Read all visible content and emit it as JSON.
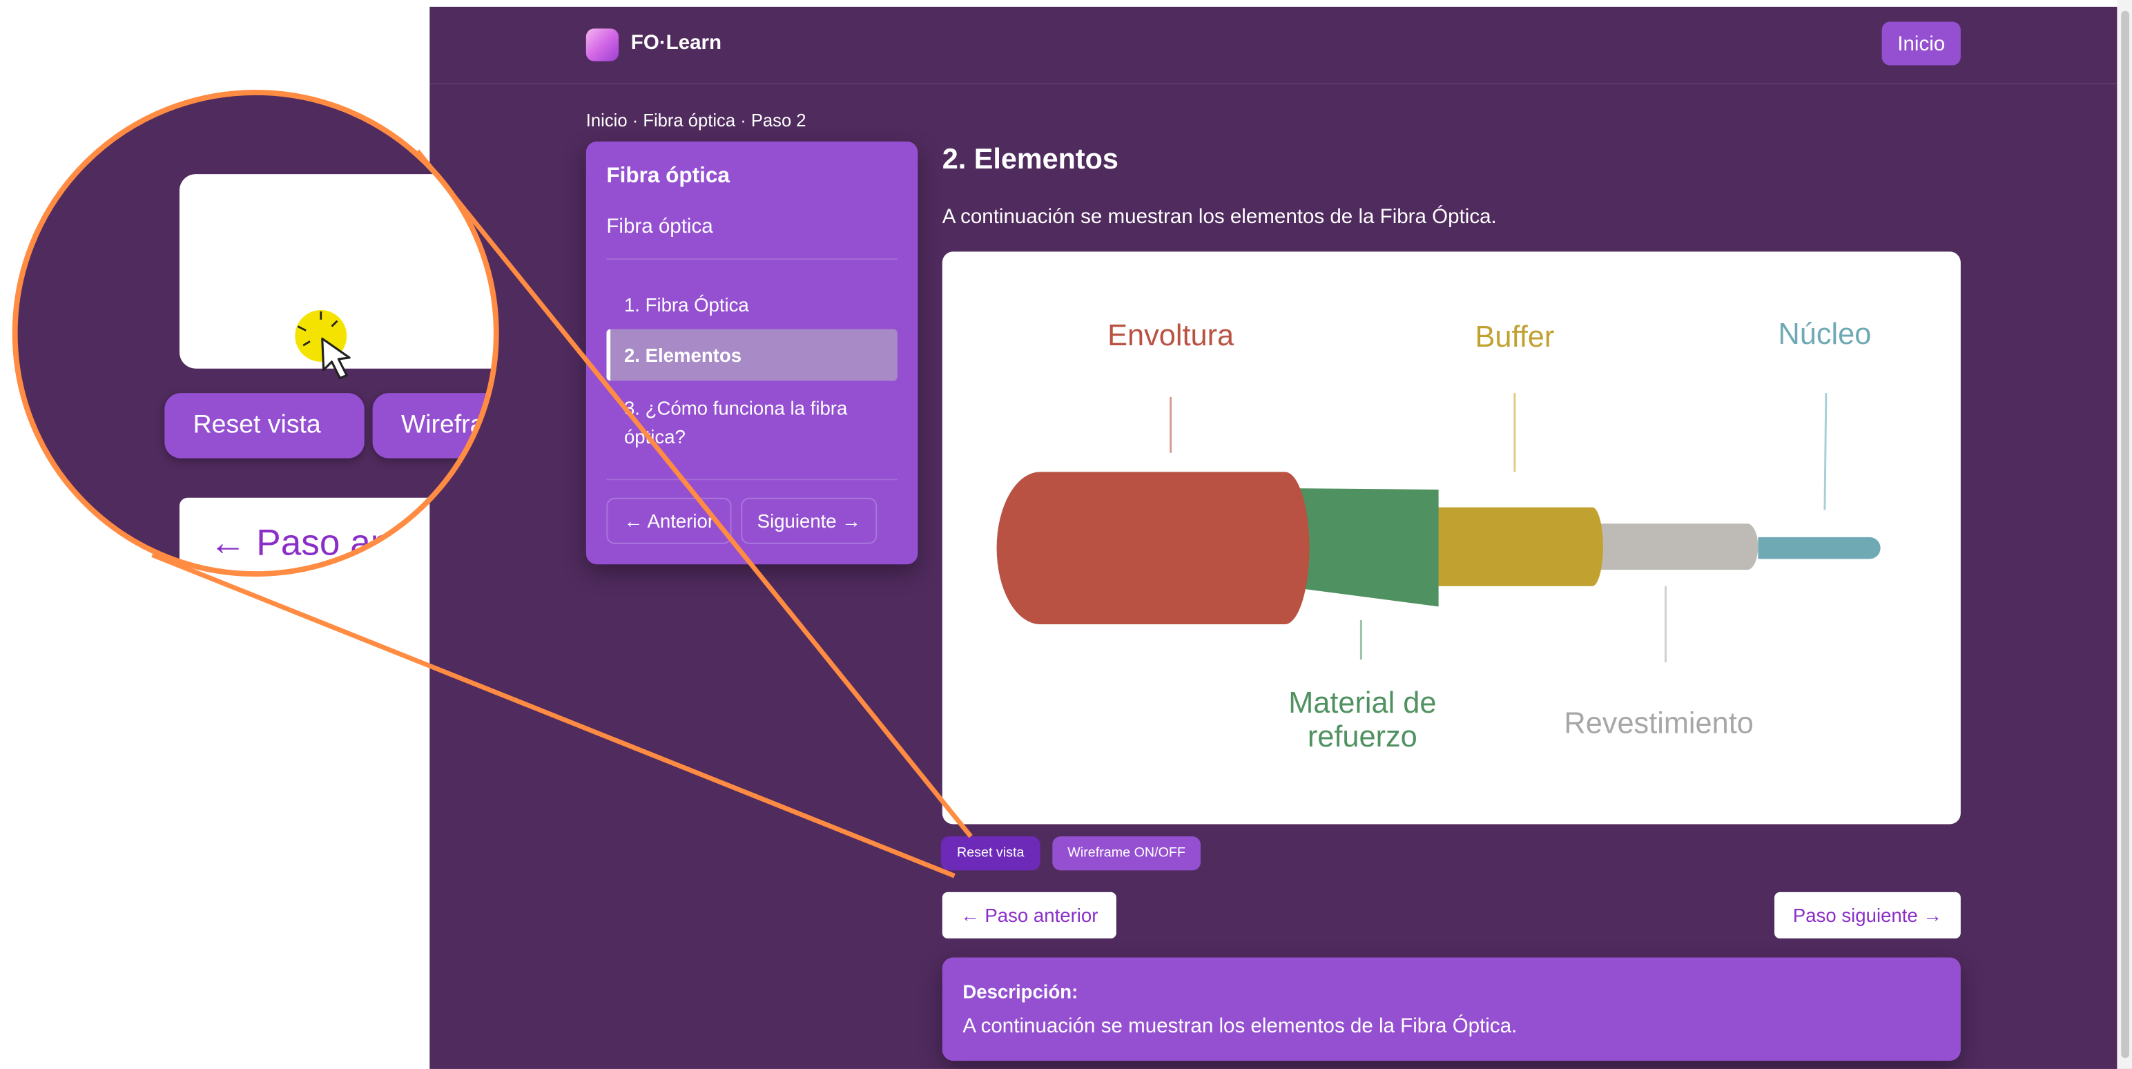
{
  "header": {
    "brand": "FO·Learn",
    "home_label": "Inicio"
  },
  "breadcrumb": "Inicio · Fibra óptica · Paso 2",
  "sidebar": {
    "title": "Fibra óptica",
    "subtitle": "Fibra óptica",
    "items": [
      {
        "label": "1. Fibra Óptica",
        "active": false
      },
      {
        "label": "2. Elementos",
        "active": true
      },
      {
        "label": "3. ¿Cómo funciona la fibra óptica?",
        "active": false
      }
    ],
    "prev_label": "← Anterior",
    "next_label": "Siguiente →"
  },
  "main": {
    "title": "2. Elementos",
    "intro": "A continuación se muestran los elementos de la Fibra Óptica.",
    "reset_label": "Reset vista",
    "wireframe_label": "Wireframe ON/OFF",
    "prev_step_label": "← Paso anterior",
    "next_step_label": "Paso siguiente →"
  },
  "model": {
    "labels": {
      "envoltura": "Envoltura",
      "buffer": "Buffer",
      "nucleo": "Núcleo",
      "material": "Material de\nrefuerzo",
      "revestimiento": "Revestimiento"
    },
    "colors": {
      "envoltura": "#b95242",
      "material": "#4f9160",
      "buffer": "#c1a231",
      "revestimiento": "#bebbb7",
      "nucleo": "#6fa9b4"
    }
  },
  "description": {
    "title": "Descripción:",
    "text": "A continuación se muestran los elementos de la Fibra Óptica."
  },
  "zoom": {
    "reset_label": "Reset vista",
    "wireframe_label": "Wireframe ON/OFF",
    "prev_label": "← Paso anterior"
  },
  "colors": {
    "page_bg": "#502b5e",
    "card": "#9550d1",
    "accent_dark": "#6d2ab8",
    "link": "#8a2ec8",
    "highlight": "#ff8c42",
    "cursor": "#f4e300"
  }
}
